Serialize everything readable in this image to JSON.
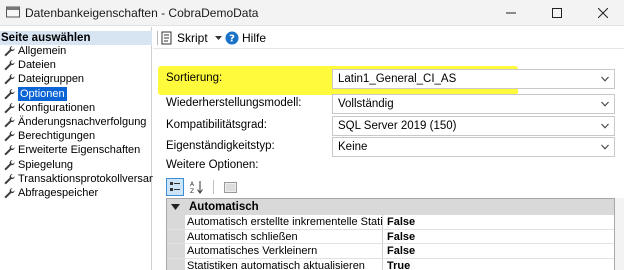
{
  "window": {
    "title": "Datenbankeigenschaften - CobraDemoData",
    "icons": {
      "app": "database-gear-icon",
      "minimize": "minimize-icon",
      "maximize": "maximize-icon",
      "close": "close-icon"
    }
  },
  "left": {
    "header": "Seite auswählen",
    "items": [
      {
        "label": "Allgemein",
        "selected": false
      },
      {
        "label": "Dateien",
        "selected": false
      },
      {
        "label": "Dateigruppen",
        "selected": false
      },
      {
        "label": "Optionen",
        "selected": true
      },
      {
        "label": "Konfigurationen",
        "selected": false
      },
      {
        "label": "Änderungsnachverfolgung",
        "selected": false
      },
      {
        "label": "Berechtigungen",
        "selected": false
      },
      {
        "label": "Erweiterte Eigenschaften",
        "selected": false
      },
      {
        "label": "Spiegelung",
        "selected": false
      },
      {
        "label": "Transaktionsprotokollversand",
        "selected": false
      },
      {
        "label": "Abfragespeicher",
        "selected": false
      }
    ],
    "item_icon": "wrench-icon"
  },
  "toolbar": {
    "script_label": "Skript",
    "help_label": "Hilfe"
  },
  "form": {
    "rows": [
      {
        "label": "Sortierung:",
        "value": "Latin1_General_CI_AS"
      },
      {
        "label": "Wiederherstellungsmodell:",
        "value": "Vollständig"
      },
      {
        "label": "Kompatibilitätsgrad:",
        "value": "SQL Server 2019 (150)"
      },
      {
        "label": "Eigenständigkeitstyp:",
        "value": "Keine"
      }
    ],
    "more_options_label": "Weitere Optionen:"
  },
  "propgrid": {
    "section": "Automatisch",
    "rows": [
      {
        "name": "Automatisch erstellte inkrementelle Statistiken",
        "value": "False"
      },
      {
        "name": "Automatisch schließen",
        "value": "False"
      },
      {
        "name": "Automatisches Verkleinern",
        "value": "False"
      },
      {
        "name": "Statistiken automatisch aktualisieren",
        "value": "True"
      }
    ]
  },
  "colors": {
    "selection": "#0a64d6",
    "highlight": "#fffb3c",
    "header_bg": "#d7e4f2"
  }
}
